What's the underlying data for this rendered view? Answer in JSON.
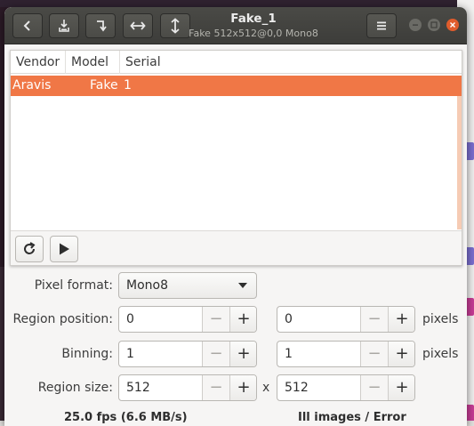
{
  "window": {
    "title": "Fake_1",
    "subtitle": "Fake 512x512@0,0 Mono8"
  },
  "headerbar": {
    "icons": [
      "chevron-left-icon",
      "snapshot-save-icon",
      "redo-arrow-icon",
      "horizontal-flip-icon",
      "vertical-flip-icon",
      "hamburger-menu-icon",
      "minimize-icon",
      "maximize-icon",
      "close-icon"
    ]
  },
  "camera_list": {
    "columns": [
      "Vendor",
      "Model",
      "Serial"
    ],
    "rows": [
      {
        "vendor": "Aravis",
        "model": "Fake",
        "serial": "1"
      }
    ],
    "selected_color": "#f07746"
  },
  "settings": {
    "pixel_format": {
      "label": "Pixel format:",
      "value": "Mono8"
    },
    "region_position": {
      "label": "Region position:",
      "x": "0",
      "y": "0",
      "unit": "pixels"
    },
    "binning": {
      "label": "Binning:",
      "x": "1",
      "y": "1",
      "unit": "pixels"
    },
    "region_size": {
      "label": "Region size:",
      "width": "512",
      "separator": "x",
      "height": "512"
    }
  },
  "status": {
    "left": "25.0 fps (6.6 MB/s)",
    "right": "Ill images / Error"
  },
  "colors": {
    "accent": "#f07746",
    "headerbar": "#3d3d3a",
    "close_button": "#e05c2c"
  }
}
